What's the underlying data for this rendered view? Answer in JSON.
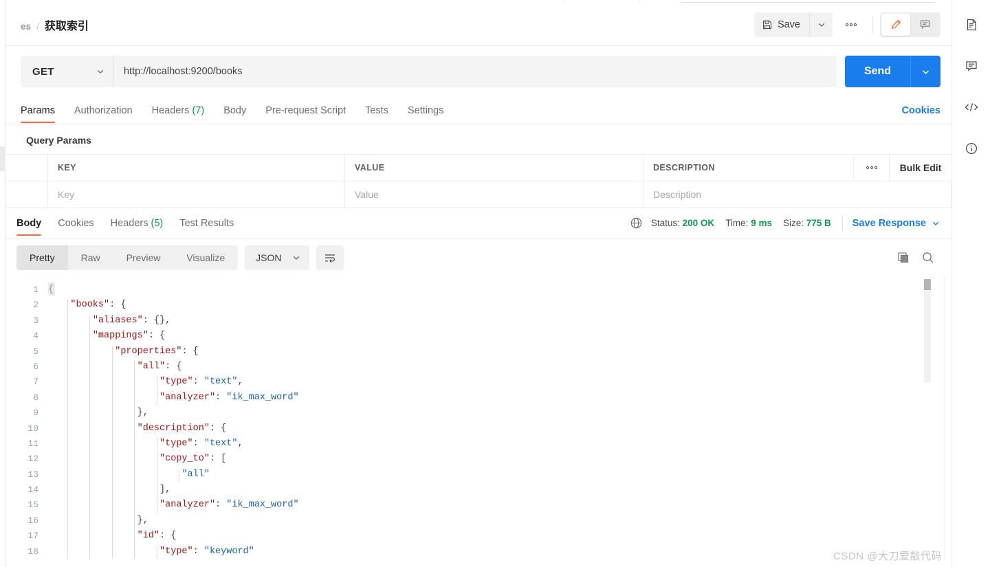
{
  "breadcrumb": {
    "parent": "es",
    "separator": "/",
    "current": "获取索引"
  },
  "header_actions": {
    "save_label": "Save",
    "save_icon": "floppy-disk-icon",
    "save_caret_icon": "chevron-down-icon",
    "more_icon": "ellipsis-icon",
    "edit_icon": "pencil-icon",
    "comment_icon": "comment-icon",
    "accent": "#ff6c37"
  },
  "request": {
    "method": "GET",
    "method_caret_icon": "chevron-down-icon",
    "url": "http://localhost:9200/books",
    "send_label": "Send",
    "send_caret_icon": "chevron-down-icon",
    "send_color": "#1a7ded"
  },
  "request_tabs": [
    {
      "label": "Params",
      "count": "",
      "active": true
    },
    {
      "label": "Authorization",
      "count": "",
      "active": false
    },
    {
      "label": "Headers",
      "count": "(7)",
      "active": false
    },
    {
      "label": "Body",
      "count": "",
      "active": false
    },
    {
      "label": "Pre-request Script",
      "count": "",
      "active": false
    },
    {
      "label": "Tests",
      "count": "",
      "active": false
    },
    {
      "label": "Settings",
      "count": "",
      "active": false
    }
  ],
  "cookies_link": "Cookies",
  "query_params": {
    "title": "Query Params",
    "columns": [
      "KEY",
      "VALUE",
      "DESCRIPTION"
    ],
    "more_icon": "ellipsis-icon",
    "bulk_edit_label": "Bulk Edit",
    "rows": [
      {
        "key_placeholder": "Key",
        "value_placeholder": "Value",
        "desc_placeholder": "Description"
      }
    ]
  },
  "response_tabs": [
    {
      "label": "Body",
      "count": "",
      "active": true
    },
    {
      "label": "Cookies",
      "count": "",
      "active": false
    },
    {
      "label": "Headers",
      "count": "(5)",
      "active": false
    },
    {
      "label": "Test Results",
      "count": "",
      "active": false
    }
  ],
  "response_meta": {
    "globe_icon": "globe-icon",
    "status_label": "Status:",
    "status_value": "200 OK",
    "time_label": "Time:",
    "time_value": "9 ms",
    "size_label": "Size:",
    "size_value": "775 B",
    "save_response_label": "Save Response",
    "save_response_caret_icon": "chevron-down-icon",
    "green": "#0f9b4a",
    "blue": "#1a7ded"
  },
  "format_bar": {
    "modes": [
      {
        "label": "Pretty",
        "active": true
      },
      {
        "label": "Raw",
        "active": false
      },
      {
        "label": "Preview",
        "active": false
      },
      {
        "label": "Visualize",
        "active": false
      }
    ],
    "language": "JSON",
    "language_caret_icon": "chevron-down-icon",
    "wrap_icon": "word-wrap-icon",
    "copy_icon": "copy-icon",
    "search_icon": "search-icon"
  },
  "code": {
    "language": "json",
    "lines": [
      {
        "n": 1,
        "indent": 0,
        "tokens": [
          {
            "t": "p",
            "v": "{"
          }
        ]
      },
      {
        "n": 2,
        "indent": 1,
        "tokens": [
          {
            "t": "k",
            "v": "\"books\""
          },
          {
            "t": "p",
            "v": ": {"
          }
        ]
      },
      {
        "n": 3,
        "indent": 2,
        "tokens": [
          {
            "t": "k",
            "v": "\"aliases\""
          },
          {
            "t": "p",
            "v": ": {},"
          }
        ]
      },
      {
        "n": 4,
        "indent": 2,
        "tokens": [
          {
            "t": "k",
            "v": "\"mappings\""
          },
          {
            "t": "p",
            "v": ": {"
          }
        ]
      },
      {
        "n": 5,
        "indent": 3,
        "tokens": [
          {
            "t": "k",
            "v": "\"properties\""
          },
          {
            "t": "p",
            "v": ": {"
          }
        ]
      },
      {
        "n": 6,
        "indent": 4,
        "tokens": [
          {
            "t": "k",
            "v": "\"all\""
          },
          {
            "t": "p",
            "v": ": {"
          }
        ]
      },
      {
        "n": 7,
        "indent": 5,
        "tokens": [
          {
            "t": "k",
            "v": "\"type\""
          },
          {
            "t": "p",
            "v": ": "
          },
          {
            "t": "s",
            "v": "\"text\""
          },
          {
            "t": "p",
            "v": ","
          }
        ]
      },
      {
        "n": 8,
        "indent": 5,
        "tokens": [
          {
            "t": "k",
            "v": "\"analyzer\""
          },
          {
            "t": "p",
            "v": ": "
          },
          {
            "t": "s",
            "v": "\"ik_max_word\""
          }
        ]
      },
      {
        "n": 9,
        "indent": 4,
        "tokens": [
          {
            "t": "p",
            "v": "},"
          }
        ]
      },
      {
        "n": 10,
        "indent": 4,
        "tokens": [
          {
            "t": "k",
            "v": "\"description\""
          },
          {
            "t": "p",
            "v": ": {"
          }
        ]
      },
      {
        "n": 11,
        "indent": 5,
        "tokens": [
          {
            "t": "k",
            "v": "\"type\""
          },
          {
            "t": "p",
            "v": ": "
          },
          {
            "t": "s",
            "v": "\"text\""
          },
          {
            "t": "p",
            "v": ","
          }
        ]
      },
      {
        "n": 12,
        "indent": 5,
        "tokens": [
          {
            "t": "k",
            "v": "\"copy_to\""
          },
          {
            "t": "p",
            "v": ": ["
          }
        ]
      },
      {
        "n": 13,
        "indent": 6,
        "tokens": [
          {
            "t": "s",
            "v": "\"all\""
          }
        ]
      },
      {
        "n": 14,
        "indent": 5,
        "tokens": [
          {
            "t": "p",
            "v": "],"
          }
        ]
      },
      {
        "n": 15,
        "indent": 5,
        "tokens": [
          {
            "t": "k",
            "v": "\"analyzer\""
          },
          {
            "t": "p",
            "v": ": "
          },
          {
            "t": "s",
            "v": "\"ik_max_word\""
          }
        ]
      },
      {
        "n": 16,
        "indent": 4,
        "tokens": [
          {
            "t": "p",
            "v": "},"
          }
        ]
      },
      {
        "n": 17,
        "indent": 4,
        "tokens": [
          {
            "t": "k",
            "v": "\"id\""
          },
          {
            "t": "p",
            "v": ": {"
          }
        ]
      },
      {
        "n": 18,
        "indent": 5,
        "tokens": [
          {
            "t": "k",
            "v": "\"type\""
          },
          {
            "t": "p",
            "v": ": "
          },
          {
            "t": "s",
            "v": "\"keyword\""
          }
        ]
      }
    ],
    "colors": {
      "key": "#a31515",
      "string": "#1a5fb4",
      "punctuation": "#444444",
      "gutter": "#9aa3ad"
    }
  },
  "right_rail": [
    {
      "icon": "document-icon"
    },
    {
      "icon": "comment-icon"
    },
    {
      "icon": "code-icon"
    },
    {
      "icon": "info-icon"
    }
  ],
  "watermark": "CSDN @大刀爱敲代码"
}
